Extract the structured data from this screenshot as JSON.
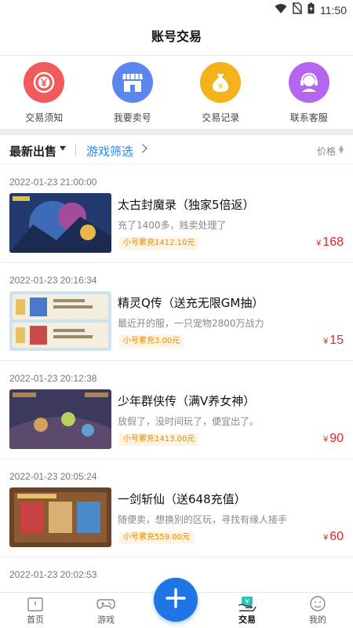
{
  "status_bar": {
    "time": "11:50",
    "icons": [
      "wifi-icon",
      "no-sim-icon",
      "battery-charging-icon"
    ]
  },
  "header": {
    "title": "账号交易"
  },
  "quick_nav": [
    {
      "label": "交易须知",
      "icon": "yuan-coin-icon",
      "color": "#ef5a5d"
    },
    {
      "label": "我要卖号",
      "icon": "store-icon",
      "color": "#5b86f0"
    },
    {
      "label": "交易记录",
      "icon": "money-bag-icon",
      "color": "#f4b21b"
    },
    {
      "label": "联系客服",
      "icon": "customer-service-icon",
      "color": "#b566ee"
    }
  ],
  "filter": {
    "latest": "最新出售",
    "game_filter": "游戏筛选",
    "price_sort": "价格"
  },
  "listings": [
    {
      "date": "2022-01-23 21:00:00",
      "title": "太古封魔录（独家5倍返）",
      "desc": "充了1400多，贱卖处理了",
      "tag": "小号累充1412.10元",
      "currency": "¥",
      "price": "168"
    },
    {
      "date": "2022-01-23 20:16:34",
      "title": "精灵Q传（送充无限GM抽）",
      "desc": "最近开的服，一只宠物2800万战力",
      "tag": "小号累充3.00元",
      "currency": "¥",
      "price": "15"
    },
    {
      "date": "2022-01-23 20:12:38",
      "title": "少年群侠传（满V养女神）",
      "desc": "放假了，没时间玩了，便宜出了。",
      "tag": "小号累充1413.00元",
      "currency": "¥",
      "price": "90"
    },
    {
      "date": "2022-01-23 20:05:24",
      "title": "一剑斩仙（送648充值）",
      "desc": "随便卖，想换别的区玩，寻找有缘人接手",
      "tag": "小号累充559.00元",
      "currency": "¥",
      "price": "60"
    },
    {
      "date": "2022-01-23 20:02:53"
    }
  ],
  "tab_bar": [
    {
      "label": "首页",
      "icon": "home-icon"
    },
    {
      "label": "游戏",
      "icon": "gamepad-icon"
    },
    {
      "label": "",
      "icon": "plus-icon"
    },
    {
      "label": "交易",
      "icon": "trade-icon",
      "active": true
    },
    {
      "label": "我的",
      "icon": "profile-icon"
    }
  ]
}
